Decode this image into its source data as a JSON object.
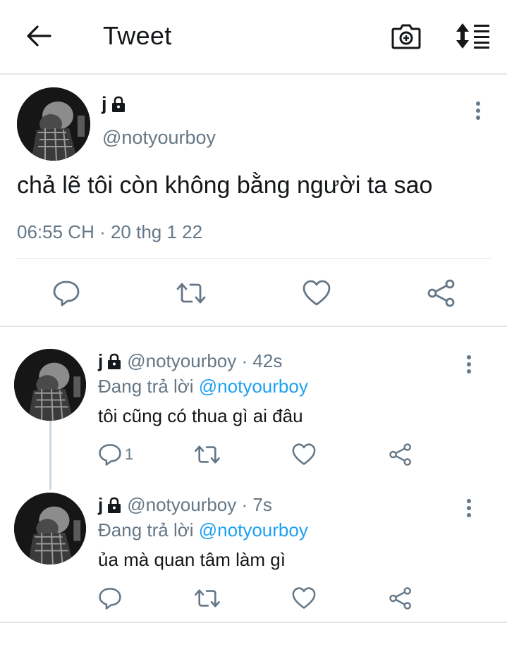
{
  "header": {
    "title": "Tweet",
    "icons": [
      "back-arrow-icon",
      "camera-icon",
      "sort-icon"
    ]
  },
  "main_tweet": {
    "name": "j",
    "handle": "@notyourboy",
    "text": "chả lẽ tôi còn không bằng người ta sao",
    "timestamp": "06:55 CH · 20 thg 1 22",
    "actions": [
      "reply-icon",
      "retweet-icon",
      "like-icon",
      "share-icon"
    ]
  },
  "replies": [
    {
      "name": "j",
      "handle": "@notyourboy",
      "time": "· 42s",
      "replying_prefix": "Đang trả lời ",
      "replying_to": "@notyourboy",
      "text": "tôi cũng có thua gì ai đâu",
      "reply_count": "1"
    },
    {
      "name": "j",
      "handle": "@notyourboy",
      "time": "· 7s",
      "replying_prefix": "Đang trả lời ",
      "replying_to": "@notyourboy",
      "text": "ủa mà quan tâm làm gì",
      "reply_count": ""
    }
  ],
  "colors": {
    "text": "#14171a",
    "secondary": "#657786",
    "accent": "#1da1f2",
    "divider": "#e1e8ed"
  }
}
